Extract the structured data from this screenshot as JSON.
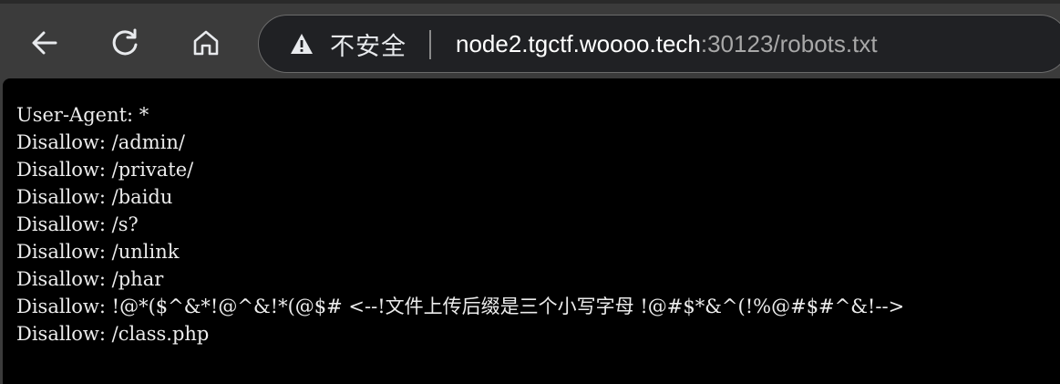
{
  "toolbar": {
    "back_icon": "arrow-left-icon",
    "reload_icon": "reload-icon",
    "home_icon": "home-icon"
  },
  "omnibox": {
    "security_icon": "warning-triangle-icon",
    "security_text": "不安全",
    "url_host": "node2.tgctf.woooo.tech",
    "url_path": ":30123/robots.txt"
  },
  "document": {
    "lines": [
      "User-Agent: *",
      "Disallow: /admin/",
      "Disallow: /private/",
      "Disallow: /baidu",
      "Disallow: /s?",
      "Disallow: /unlink",
      "Disallow: /phar",
      "Disallow: !@*($^&*!@^&!*(@$# <--!文件上传后缀是三个小写字母 !@#$*&^(!%@#$#^&!-->",
      "Disallow: /class.php"
    ]
  },
  "colors": {
    "toolbar_bg": "#3b3b3b",
    "omnibox_bg": "#202124",
    "page_bg": "#000000",
    "text": "#ececec"
  }
}
